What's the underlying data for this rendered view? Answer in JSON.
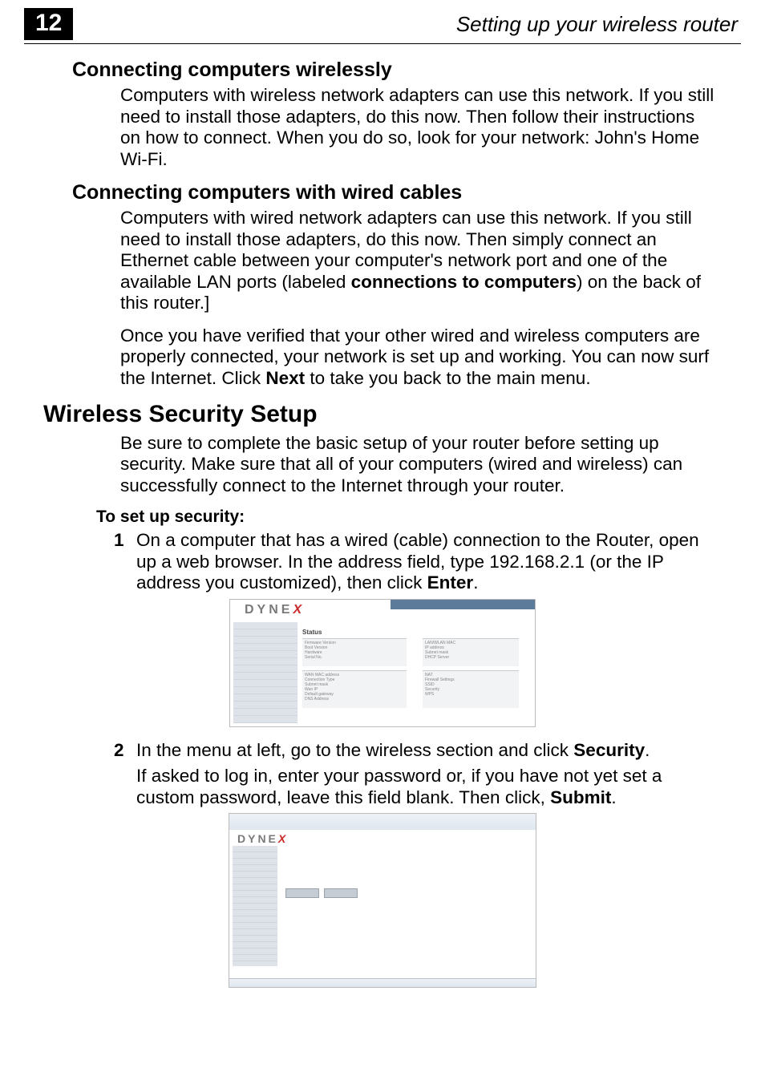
{
  "header": {
    "page_number": "12",
    "running_title": "Setting up your wireless router"
  },
  "sections": {
    "wireless_h": "Connecting computers wirelessly",
    "wireless_p": "Computers with wireless network adapters can use this network. If you still need to install those adapters, do this now. Then follow their instructions on how to connect. When you do so, look for your network: John's Home Wi-Fi.",
    "wired_h": "Connecting computers with wired cables",
    "wired_p1a": "Computers with wired network adapters can use this network. If you still need to install those adapters, do this now. Then simply connect an Ethernet cable between your computer's network port and one of the available LAN ports (labeled ",
    "wired_p1b": "connections to computers",
    "wired_p1c": ") on the back of this router.]",
    "wired_p2a": "Once you have verified that your other wired and wireless computers are properly connected, your network is set up and working. You can now surf the Internet. Click ",
    "wired_p2b": "Next",
    "wired_p2c": " to take you back to the main menu."
  },
  "security": {
    "h": "Wireless Security Setup",
    "intro": "Be sure to complete the basic setup of your router before setting up security. Make sure that all of your computers (wired and wireless) can successfully connect to the Internet through your router.",
    "subhead": "To set up security:",
    "step1_num": "1",
    "step1a": "On a computer that has a wired (cable) connection to the Router, open up a web browser. In the address field, type 192.168.2.1 (or the IP address you customized), then click ",
    "step1b": "Enter",
    "step1c": ".",
    "step2_num": "2",
    "step2a": "In the menu at left, go to the wireless section and click ",
    "step2b": "Security",
    "step2c": ".",
    "step2_cont_a": "If asked to log in, enter your password or, if you have not yet set a custom password, leave this field blank. Then click, ",
    "step2_cont_b": "Submit",
    "step2_cont_c": "."
  },
  "shots": {
    "brand": "DYNE",
    "brand_x": "X",
    "status": "Status"
  }
}
